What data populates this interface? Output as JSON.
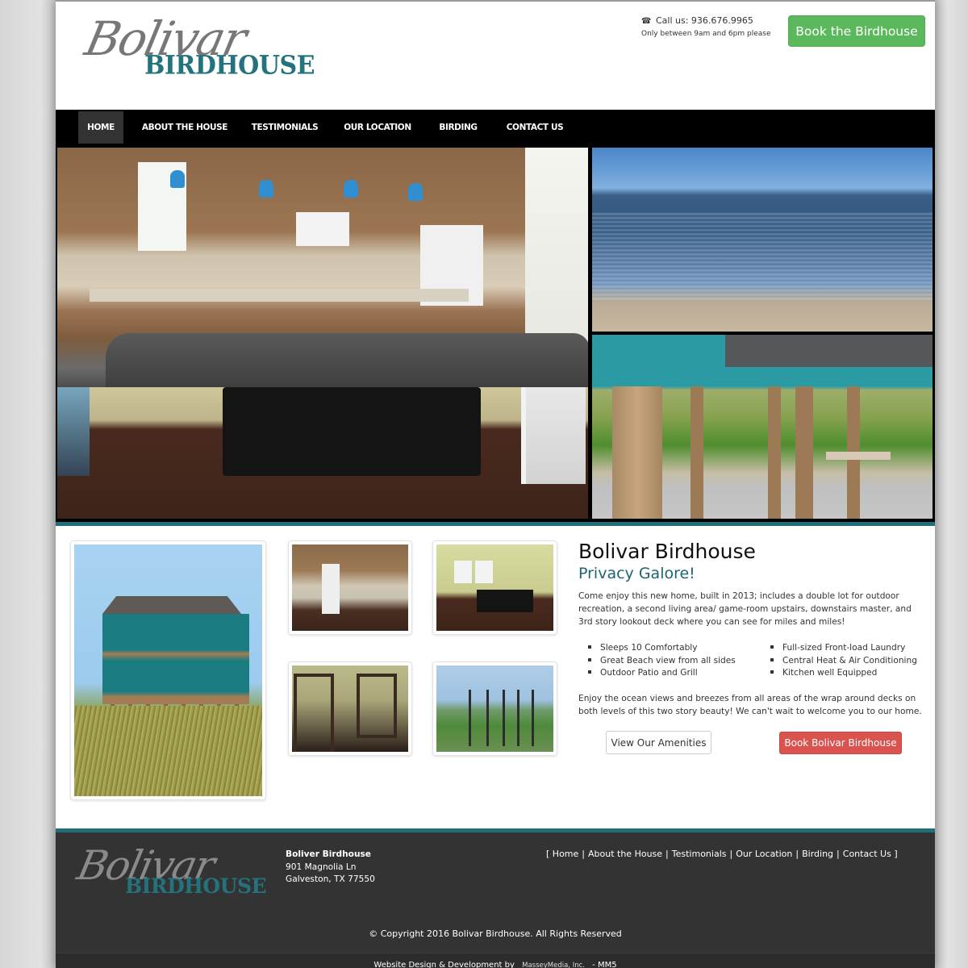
{
  "header": {
    "logo_script": "Bolivar",
    "logo_word": "BIRDHOUSE",
    "phone_icon": "phone-icon",
    "call_label": "Call us: 936.676.9965",
    "hours": "Only between 9am and 6pm please",
    "book_button": "Book the Birdhouse"
  },
  "nav": {
    "items": [
      {
        "label": "HOME",
        "active": true
      },
      {
        "label": "ABOUT THE HOUSE",
        "active": false
      },
      {
        "label": "TESTIMONIALS",
        "active": false
      },
      {
        "label": "OUR LOCATION",
        "active": false
      },
      {
        "label": "BIRDING",
        "active": false
      },
      {
        "label": "CONTACT US",
        "active": false
      }
    ]
  },
  "hero": {
    "photos": [
      "kitchen",
      "beach-with-birds",
      "living-room",
      "patio-under-house"
    ]
  },
  "gallery": {
    "photos": [
      "house-exterior",
      "kitchen",
      "living-room",
      "bunk-room",
      "street-view"
    ]
  },
  "about": {
    "title": "Bolivar Birdhouse",
    "subtitle": "Privacy Galore!",
    "intro": "Come enjoy this new home, built in 2013; includes a double lot for outdoor recreation, a second living area/ game-room upstairs, downstairs master, and 3rd story lookout deck where you can see for miles and miles!",
    "features_left": [
      "Sleeps 10 Comfortably",
      "Great Beach view from all sides",
      "Outdoor Patio and Grill"
    ],
    "features_right": [
      "Full-sized Front-load Laundry",
      "Central Heat & Air Conditioning",
      "Kitchen well Equipped"
    ],
    "outro": "Enjoy the ocean views and breezes from all areas of the wrap around decks on both levels of this two story beauty! We can't wait to welcome you to our home.",
    "amenities_button": "View Our Amenities",
    "book_button": "Book Bolivar Birdhouse"
  },
  "footer": {
    "logo_script": "Bolivar",
    "logo_word": "BIRDHOUSE",
    "name": "Boliver Birdhouse",
    "street": "901 Magnolia Ln",
    "city": "Galveston, TX 77550",
    "link_open": "[",
    "link_close": "]",
    "links": [
      "Home",
      "About the House",
      "Testimonials",
      "Our Location",
      "Birding",
      "Contact Us"
    ],
    "copyright": "© Copyright 2016 Bolivar Birdhouse. All Rights Reserved",
    "credit_prefix": "Website Design & Development by",
    "credit_company": "MasseyMedia, Inc.",
    "credit_suffix": "- MM5"
  },
  "colors": {
    "teal": "#1f6f78",
    "green_button": "#5cb85c",
    "red_button": "#d9534f",
    "nav_bg": "#000000",
    "footer_bg": "#333333"
  }
}
